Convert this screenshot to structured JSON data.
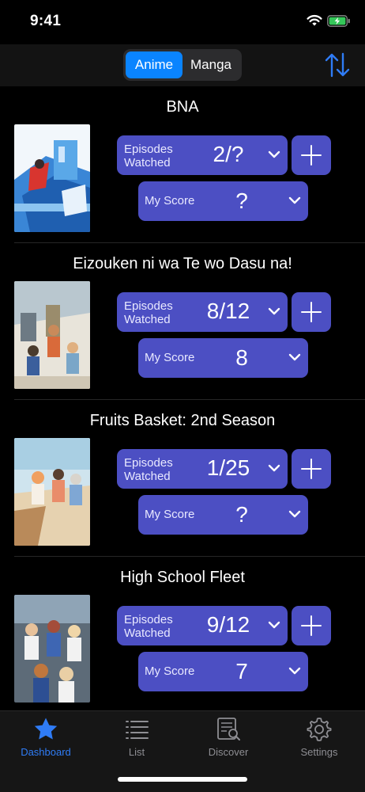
{
  "status_bar": {
    "time": "9:41"
  },
  "header": {
    "segments": [
      {
        "label": "Anime",
        "selected": true
      },
      {
        "label": "Manga",
        "selected": false
      }
    ],
    "accent": "#0a84ff"
  },
  "button_color": "#4c4fc3",
  "entries": [
    {
      "title": "BNA",
      "episodes_label": "Episodes Watched",
      "episodes": "2/?",
      "score_label": "My Score",
      "score": "?"
    },
    {
      "title": "Eizouken ni wa Te wo Dasu na!",
      "episodes_label": "Episodes Watched",
      "episodes": "8/12",
      "score_label": "My Score",
      "score": "8"
    },
    {
      "title": "Fruits Basket: 2nd Season",
      "episodes_label": "Episodes Watched",
      "episodes": "1/25",
      "score_label": "My Score",
      "score": "?"
    },
    {
      "title": "High School Fleet",
      "episodes_label": "Episodes Watched",
      "episodes": "9/12",
      "score_label": "My Score",
      "score": "7"
    }
  ],
  "tabs": [
    {
      "label": "Dashboard",
      "icon": "star-icon",
      "active": true
    },
    {
      "label": "List",
      "icon": "list-icon",
      "active": false
    },
    {
      "label": "Discover",
      "icon": "discover-icon",
      "active": false
    },
    {
      "label": "Settings",
      "icon": "gear-icon",
      "active": false
    }
  ]
}
